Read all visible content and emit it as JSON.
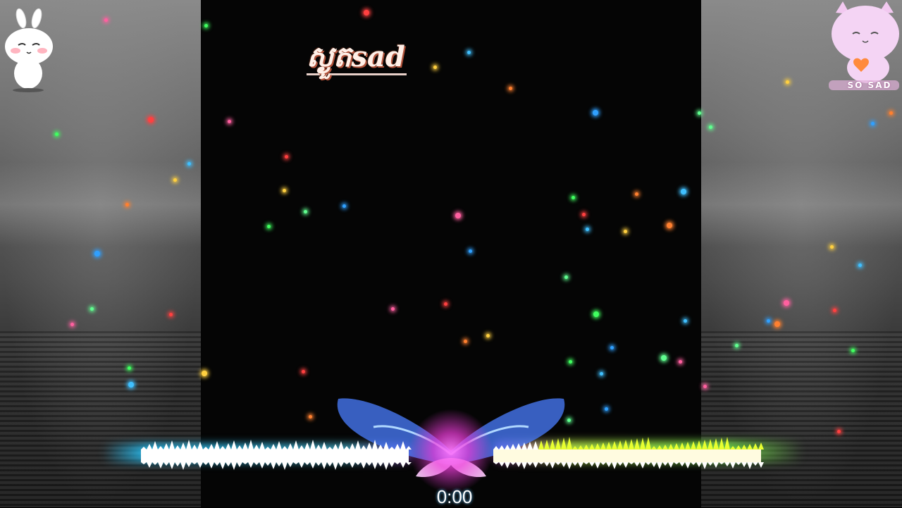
{
  "video": {
    "title": "ស្ងួតsad",
    "timestamp": "0:00"
  },
  "stickers": {
    "left_icon": "bunny-sticker-icon",
    "right_icon": "pink-cat-heart-sticker-icon",
    "right_caption": "SO SAD"
  },
  "visualizer": {
    "icon": "butterfly-icon",
    "left_color": "#3fd0ff",
    "right_color": "#c8ff3a",
    "core_color": "#ff60f0"
  }
}
